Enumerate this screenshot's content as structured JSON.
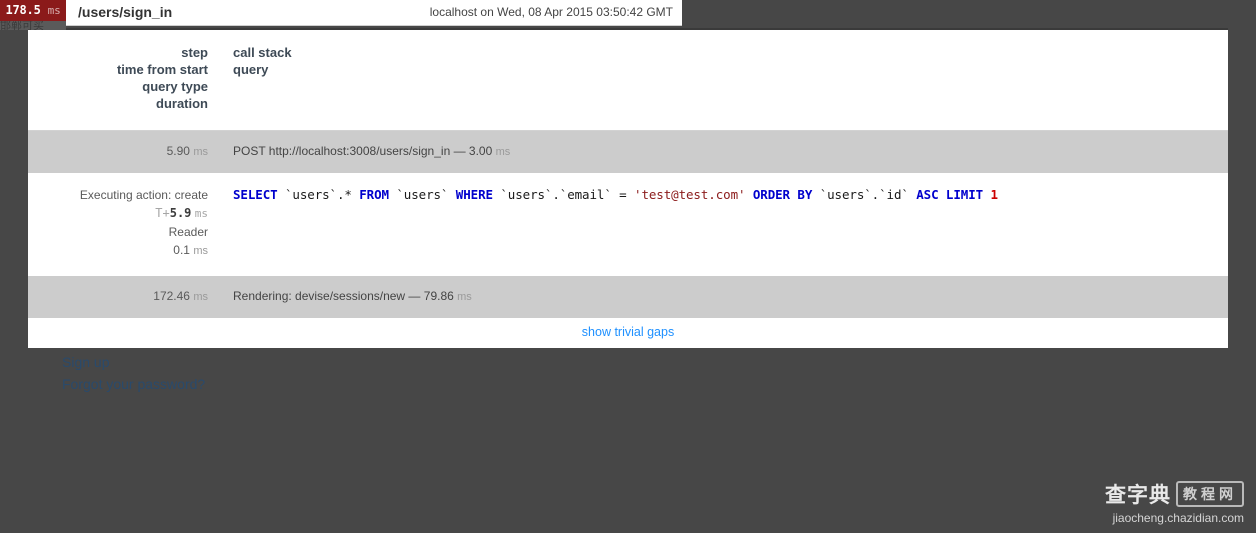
{
  "topbar": {
    "total_time": "178.5",
    "total_time_unit": "ms",
    "shadow_text": "邯郸可买",
    "page_title": "/users/sign_in",
    "env_stamp": "localhost on Wed, 08 Apr 2015 03:50:42 GMT"
  },
  "panel": {
    "headers": {
      "left": [
        "step",
        "time from start",
        "query type",
        "duration"
      ],
      "right": [
        "call stack",
        "query"
      ]
    },
    "rows": [
      {
        "kind": "request",
        "left_time": "5.90",
        "left_time_unit": "ms",
        "right_text": "POST http://localhost:3008/users/sign_in — 3.00",
        "right_unit": "ms"
      },
      {
        "kind": "query",
        "left_step": "Executing action: create",
        "left_offset_prefix": "T+",
        "left_offset_value": "5.9",
        "left_offset_unit": "ms",
        "left_query_type": "Reader",
        "left_duration": "0.1",
        "left_duration_unit": "ms",
        "sql_tokens": [
          {
            "t": "SELECT",
            "c": "kw"
          },
          {
            "t": "  `users`.* ",
            "c": "id"
          },
          {
            "t": "FROM",
            "c": "kw"
          },
          {
            "t": " `users` ",
            "c": "id"
          },
          {
            "t": "WHERE",
            "c": "kw"
          },
          {
            "t": " `users`.`email` = ",
            "c": "id"
          },
          {
            "t": "'test@test.com'",
            "c": "str"
          },
          {
            "t": "  ",
            "c": "id"
          },
          {
            "t": "ORDER BY",
            "c": "kw"
          },
          {
            "t": " `users`.`id` ",
            "c": "id"
          },
          {
            "t": "ASC LIMIT",
            "c": "kw"
          },
          {
            "t": " ",
            "c": "id"
          },
          {
            "t": "1",
            "c": "num"
          }
        ]
      },
      {
        "kind": "render",
        "left_time": "172.46",
        "left_time_unit": "ms",
        "right_text": "Rendering: devise/sessions/new — 79.86",
        "right_unit": "ms"
      }
    ],
    "footer_link": "show trivial gaps"
  },
  "underlying_page": {
    "links": [
      "Sign up",
      "Forgot your password?"
    ]
  },
  "watermark": {
    "brand_cn": "查字典",
    "badge_cn": "教程网",
    "url": "jiaocheng.chazidian.com"
  },
  "colors": {
    "badge_red": "#8b1a1a",
    "overlay": "#474747",
    "row_alt": "#cccccc",
    "link_blue": "#1e90ff",
    "sql_keyword": "#0000cd",
    "sql_string": "#8b1a1a",
    "sql_number": "#cc0000"
  }
}
